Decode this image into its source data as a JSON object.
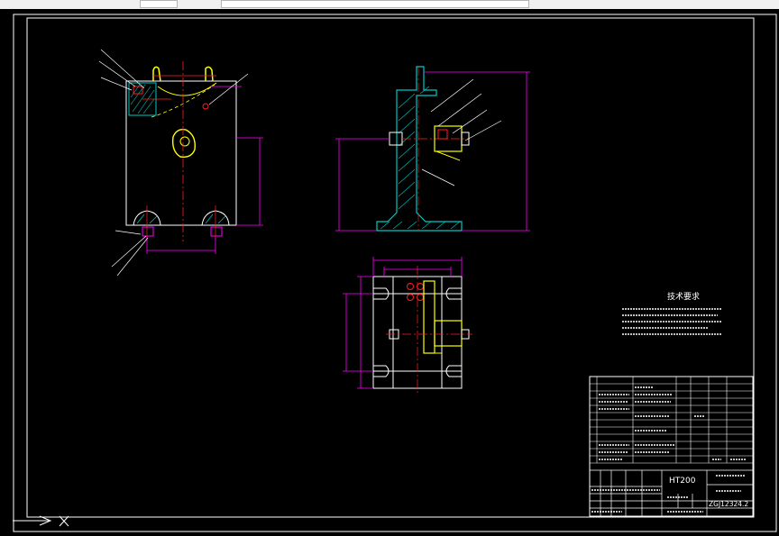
{
  "title_block": {
    "material": "HT200",
    "drawing_number": "ZGJ12324.2"
  },
  "technical_requirements": {
    "heading": "技术要求"
  },
  "colors": {
    "background": "#000000",
    "outline": "#ffffff",
    "dimension": "#ff00ff",
    "centerline": "#ff2020",
    "part": "#ffff00",
    "hatch": "#00c8c8",
    "leader": "#ffffff"
  },
  "icons": {
    "ucs_icon": "ucs-axis-icon"
  }
}
